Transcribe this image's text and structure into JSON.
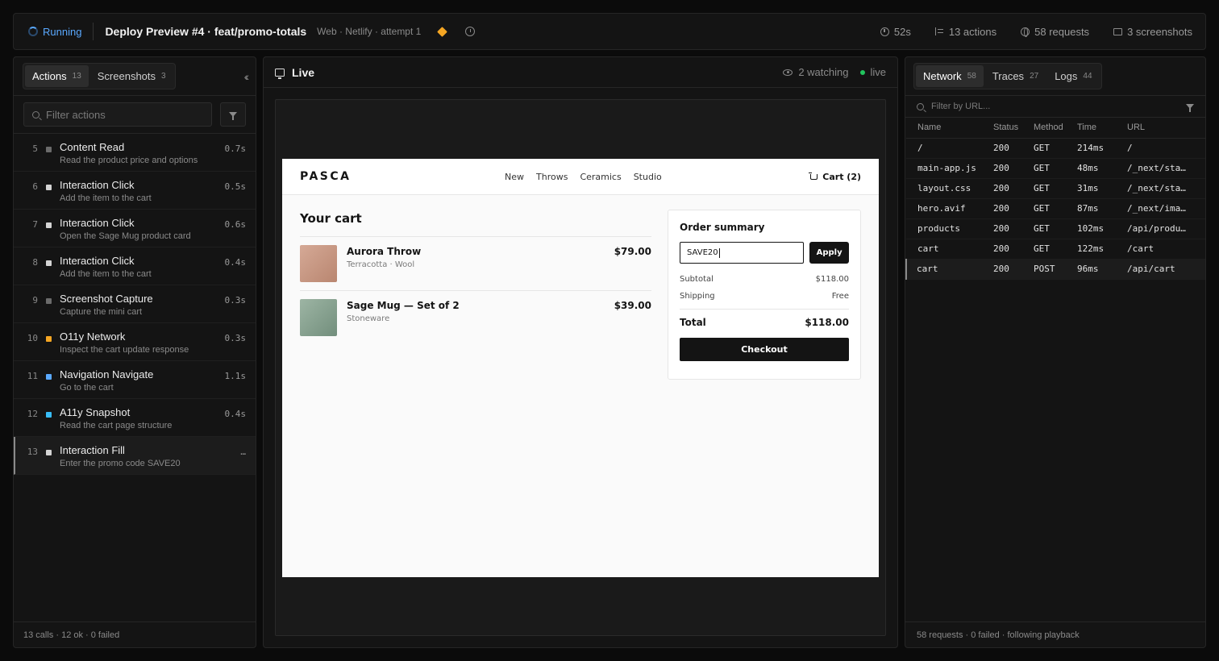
{
  "topbar": {
    "status": "Running",
    "title": "Deploy Preview #4 · feat/promo-totals",
    "subtitle": "Web · Netlify · attempt 1",
    "duration": "52s",
    "actions": "13 actions",
    "requests": "58 requests",
    "screenshots": "3 screenshots"
  },
  "left": {
    "tabs": [
      {
        "label": "Actions",
        "count": "13"
      },
      {
        "label": "Screenshots",
        "count": "3"
      }
    ],
    "filter_placeholder": "Filter actions",
    "actions": [
      {
        "num": "5",
        "title": "Content Read",
        "desc": "Read the product price and options",
        "time": "0.7s",
        "color": "#6b6b6b"
      },
      {
        "num": "6",
        "title": "Interaction Click",
        "desc": "Add the item to the cart",
        "time": "0.5s",
        "color": "#d4d4d4"
      },
      {
        "num": "7",
        "title": "Interaction Click",
        "desc": "Open the Sage Mug product card",
        "time": "0.6s",
        "color": "#d4d4d4"
      },
      {
        "num": "8",
        "title": "Interaction Click",
        "desc": "Add the item to the cart",
        "time": "0.4s",
        "color": "#d4d4d4"
      },
      {
        "num": "9",
        "title": "Screenshot Capture",
        "desc": "Capture the mini cart",
        "time": "0.3s",
        "color": "#6b6b6b"
      },
      {
        "num": "10",
        "title": "O11y Network",
        "desc": "Inspect the cart update response",
        "time": "0.3s",
        "color": "#f5a623"
      },
      {
        "num": "11",
        "title": "Navigation Navigate",
        "desc": "Go to the cart",
        "time": "1.1s",
        "color": "#5aa9ff"
      },
      {
        "num": "12",
        "title": "A11y Snapshot",
        "desc": "Read the cart page structure",
        "time": "0.4s",
        "color": "#38bdf8"
      },
      {
        "num": "13",
        "title": "Interaction Fill",
        "desc": "Enter the promo code SAVE20",
        "time": "…",
        "color": "#d4d4d4"
      }
    ],
    "footer": "13 calls · 12 ok · 0 failed"
  },
  "center": {
    "title": "Live",
    "watching": "2 watching",
    "live": "live",
    "site": {
      "logo": "PASCA",
      "nav": [
        "New",
        "Throws",
        "Ceramics",
        "Studio"
      ],
      "cart_link": "Cart (2)",
      "heading": "Your cart",
      "items": [
        {
          "name": "Aurora Throw",
          "sub": "Terracotta · Wool",
          "price": "$79.00",
          "thumb_color": "#c99a86"
        },
        {
          "name": "Sage Mug — Set of 2",
          "sub": "Stoneware",
          "price": "$39.00",
          "thumb_color": "#8aa593"
        }
      ],
      "summary": {
        "title": "Order summary",
        "promo_value": "SAVE20",
        "apply": "Apply",
        "subtotal_label": "Subtotal",
        "subtotal": "$118.00",
        "shipping_label": "Shipping",
        "shipping": "Free",
        "total_label": "Total",
        "total": "$118.00",
        "checkout": "Checkout"
      }
    }
  },
  "right": {
    "tabs": [
      {
        "label": "Network",
        "count": "58"
      },
      {
        "label": "Traces",
        "count": "27"
      },
      {
        "label": "Logs",
        "count": "44"
      }
    ],
    "filter_placeholder": "Filter by URL...",
    "columns": [
      "Name",
      "Status",
      "Method",
      "Time",
      "URL"
    ],
    "rows": [
      {
        "name": "/",
        "status": "200",
        "method": "GET",
        "time": "214ms",
        "url": "/"
      },
      {
        "name": "main-app.js",
        "status": "200",
        "method": "GET",
        "time": "48ms",
        "url": "/_next/sta…"
      },
      {
        "name": "layout.css",
        "status": "200",
        "method": "GET",
        "time": "31ms",
        "url": "/_next/sta…"
      },
      {
        "name": "hero.avif",
        "status": "200",
        "method": "GET",
        "time": "87ms",
        "url": "/_next/ima…"
      },
      {
        "name": "products",
        "status": "200",
        "method": "GET",
        "time": "102ms",
        "url": "/api/produ…"
      },
      {
        "name": "cart",
        "status": "200",
        "method": "GET",
        "time": "122ms",
        "url": "/cart"
      },
      {
        "name": "cart",
        "status": "200",
        "method": "POST",
        "time": "96ms",
        "url": "/api/cart"
      }
    ],
    "footer": "58 requests · 0 failed · following playback"
  }
}
